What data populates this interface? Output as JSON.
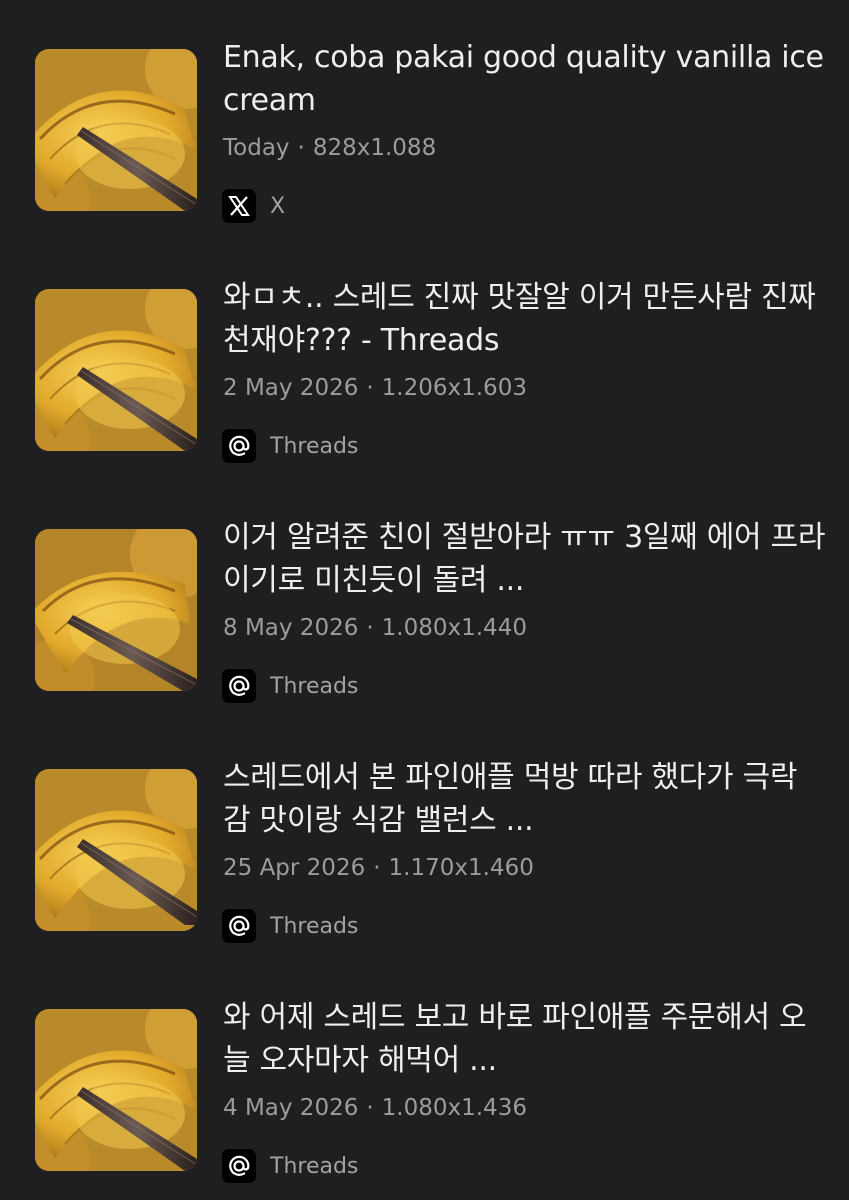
{
  "results": [
    {
      "title": "Enak, coba pakai good quality vanilla ice cream",
      "date": "Today",
      "dimensions": "828x1.088",
      "source_name": "X",
      "source_icon": "x-logo-icon",
      "thumbnail": "pineapple-chopsticks-image"
    },
    {
      "title": "와ㅁㅊ.. 스레드 진짜 맛잘알 이거 만든사람 진짜 천재야??? - Threads",
      "date": "2 May 2026",
      "dimensions": "1.206x1.603",
      "source_name": "Threads",
      "source_icon": "threads-logo-icon",
      "thumbnail": "pineapple-chopsticks-image"
    },
    {
      "title": "이거 알려준 친이 절받아라 ㅠㅠ 3일째 에어 프라이기로 미친듯이 돌려 ...",
      "date": "8 May 2026",
      "dimensions": "1.080x1.440",
      "source_name": "Threads",
      "source_icon": "threads-logo-icon",
      "thumbnail": "pineapple-chopsticks-image"
    },
    {
      "title": "스레드에서 본 파인애플 먹방 따라 했다가 극락 감 맛이랑 식감 밸런스 ...",
      "date": "25 Apr 2026",
      "dimensions": "1.170x1.460",
      "source_name": "Threads",
      "source_icon": "threads-logo-icon",
      "thumbnail": "pineapple-chopsticks-image"
    },
    {
      "title": "와 어제 스레드 보고 바로 파인애플 주문해서 오늘 오자마자 해먹어 ...",
      "date": "4 May 2026",
      "dimensions": "1.080x1.436",
      "source_name": "Threads",
      "source_icon": "threads-logo-icon",
      "thumbnail": "pineapple-chopsticks-image"
    }
  ],
  "meta_separator": "·",
  "colors": {
    "background": "#1f1f21",
    "title": "#eeeeef",
    "meta": "#9c9ca0",
    "source": "#a2a2a6",
    "pineapple_gold": "#e0a72a"
  }
}
